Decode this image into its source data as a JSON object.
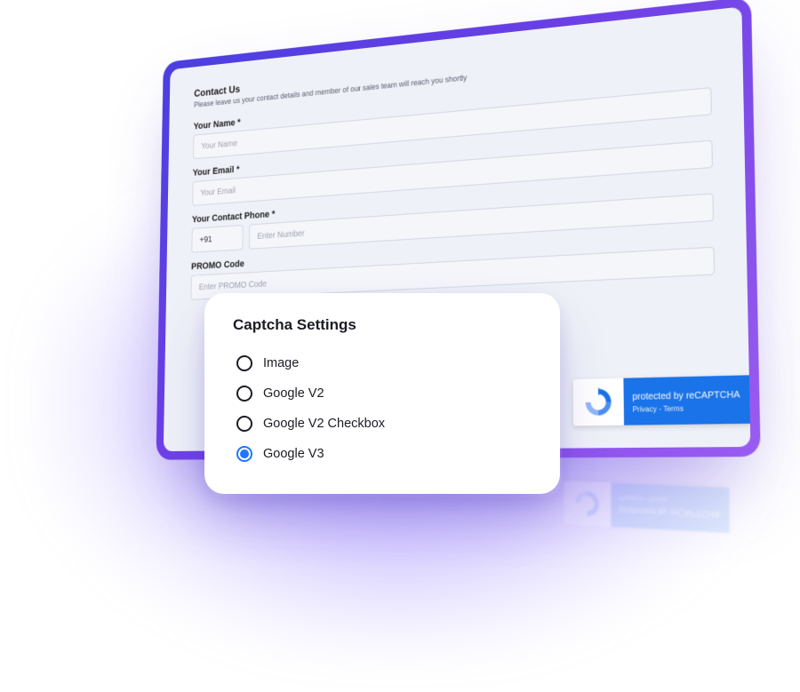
{
  "form": {
    "heading": "Contact Us",
    "subheading": "Please leave us your contact details and member of our sales team will reach you shortly",
    "fields": {
      "name": {
        "label": "Your Name *",
        "placeholder": "Your Name",
        "value": ""
      },
      "email": {
        "label": "Your Email *",
        "placeholder": "Your Email",
        "value": ""
      },
      "phone": {
        "label": "Your Contact Phone *",
        "cc_value": "+91",
        "num_placeholder": "Enter Number",
        "num_value": ""
      },
      "promo": {
        "label": "PROMO Code",
        "placeholder": "Enter PROMO Code",
        "value": ""
      }
    }
  },
  "recaptcha": {
    "line1": "protected by reCAPTCHA",
    "privacy": "Privacy",
    "sep": " - ",
    "terms": "Terms"
  },
  "captcha_card": {
    "title": "Captcha Settings",
    "options": [
      {
        "label": "Image",
        "selected": false
      },
      {
        "label": "Google V2",
        "selected": false
      },
      {
        "label": "Google V2 Checkbox",
        "selected": false
      },
      {
        "label": "Google V3",
        "selected": true
      }
    ]
  }
}
